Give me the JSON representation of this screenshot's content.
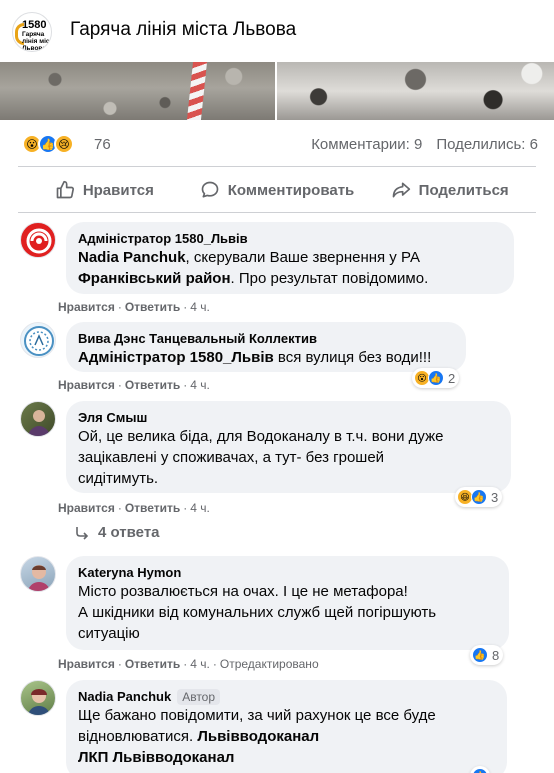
{
  "header": {
    "logo_number": "1580",
    "logo_subtitle": "Гаряча лінія міста Львова",
    "title": "Гаряча лінія міста Львова"
  },
  "reactions": {
    "icons": [
      "wow-reaction",
      "like-reaction",
      "sad-reaction"
    ],
    "count": "76",
    "comments_label": "Комментарии: 9",
    "shares_label": "Поделились: 6"
  },
  "actions": {
    "like_label": "Нравится",
    "comment_label": "Комментировать",
    "share_label": "Поделиться"
  },
  "comments": [
    {
      "author": "Адміністратор 1580_Львів",
      "mention": "Nadia Panchuk",
      "text_part1": ", скерували Ваше звернення у РА",
      "bold2": "Франківський район",
      "text_part2": ". Про результат повідомимо.",
      "like": "Нравится",
      "reply": "Ответить",
      "time": "4 ч."
    },
    {
      "author": "Вива Дэнс Танцевальный Коллектив",
      "mention": "Адміністратор 1580_Львів",
      "text": " вся вулиця без води!!!",
      "like": "Нравится",
      "reply": "Ответить",
      "time": "4 ч.",
      "reaction_count": "2"
    },
    {
      "author": "Эля Смыш",
      "line1": "Ой, це велика біда, для Водоканалу в т.ч. вони дуже",
      "line2": "зацікавлені у споживачах, а тут- без грошей",
      "line3": "сидітимуть.",
      "like": "Нравится",
      "reply": "Ответить",
      "time": "4 ч.",
      "reaction_count": "3"
    },
    {
      "author": "Kateryna Hymon",
      "line1": "Місто розвалюється на очах. І це не метафора!",
      "line2": "А шкідники від комунальних служб щей погіршують",
      "line3": "ситуацію",
      "like": "Нравится",
      "reply": "Ответить",
      "time": "4 ч.",
      "edited": "Отредактировано",
      "reaction_count": "8"
    },
    {
      "author": "Nadia Panchuk",
      "badge": "Автор",
      "line1": "Ще бажано повідомити, за чий рахунок це все буде",
      "line2_text": "відновлюватися. ",
      "line2_bold": "Львівводоканал",
      "line3_bold": "ЛКП Львівводоканал"
    }
  ],
  "replies": {
    "label": "4 ответа"
  },
  "colors": {
    "accent": "#1877f2",
    "muted_text": "#65676b",
    "bubble": "#f0f2f5",
    "reaction_yellow": "#f7b125"
  }
}
